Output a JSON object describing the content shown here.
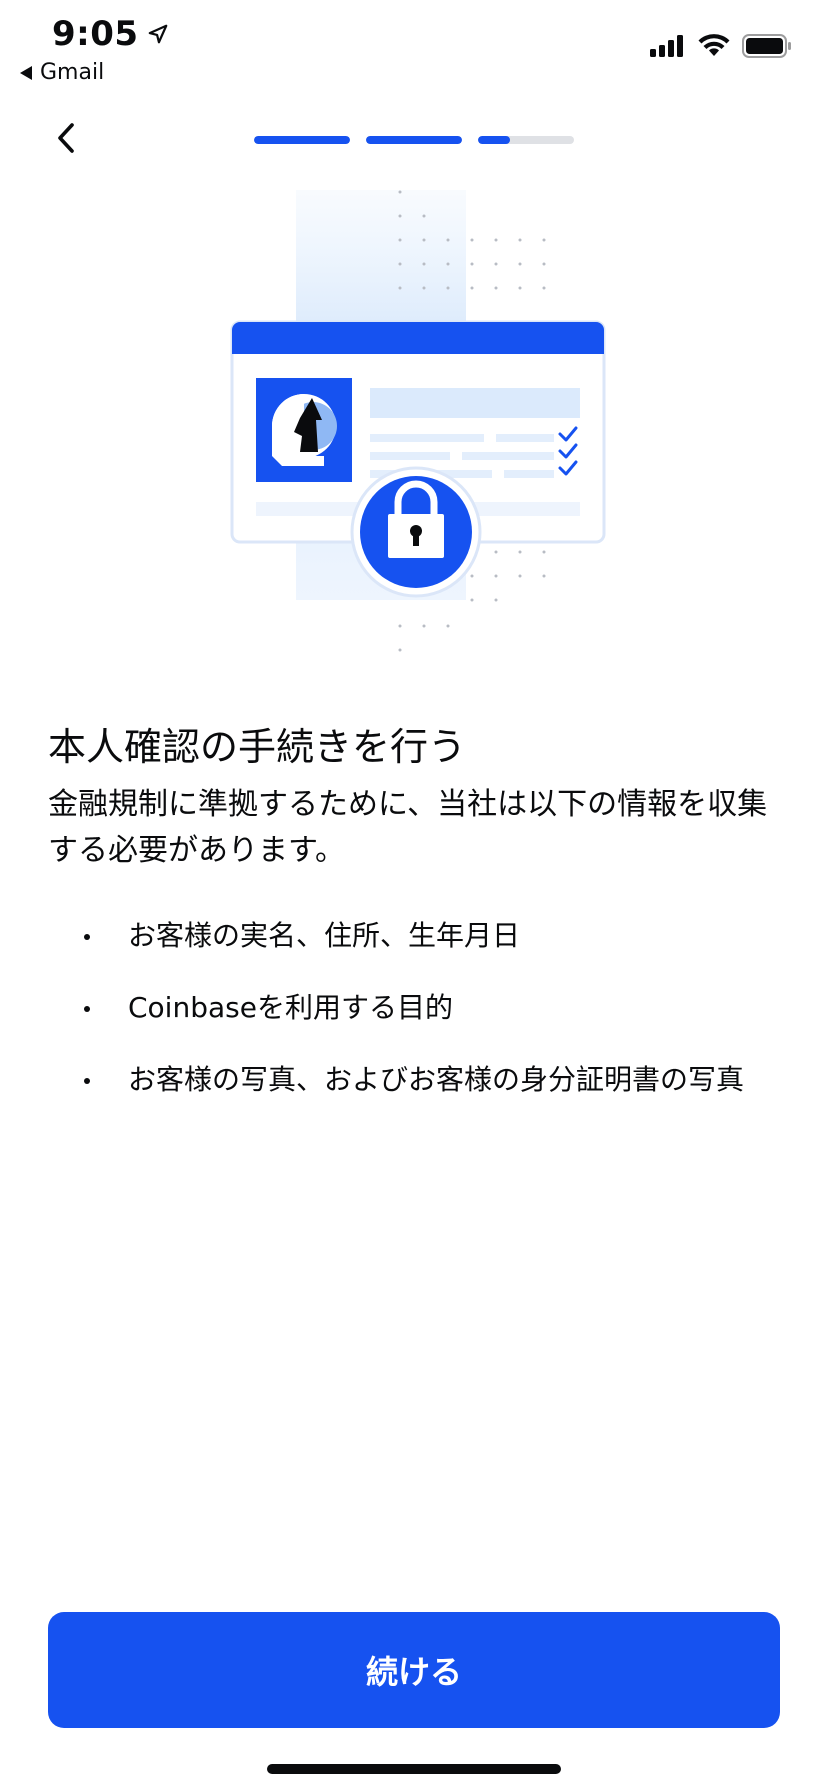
{
  "status_bar": {
    "time": "9:05",
    "back_app_label": "Gmail"
  },
  "header": {
    "progress": [
      1,
      1,
      0.33
    ],
    "accent_color": "#1652f0"
  },
  "content": {
    "title": "本人確認の手続きを行う",
    "description": "金融規制に準拠するために、当社は以下の情報を収集する必要があります。",
    "bullets": [
      "お客様の実名、住所、生年月日",
      "Coinbaseを利用する目的",
      "お客様の写真、およびお客様の身分証明書の写真"
    ]
  },
  "footer": {
    "continue_label": "続ける"
  }
}
